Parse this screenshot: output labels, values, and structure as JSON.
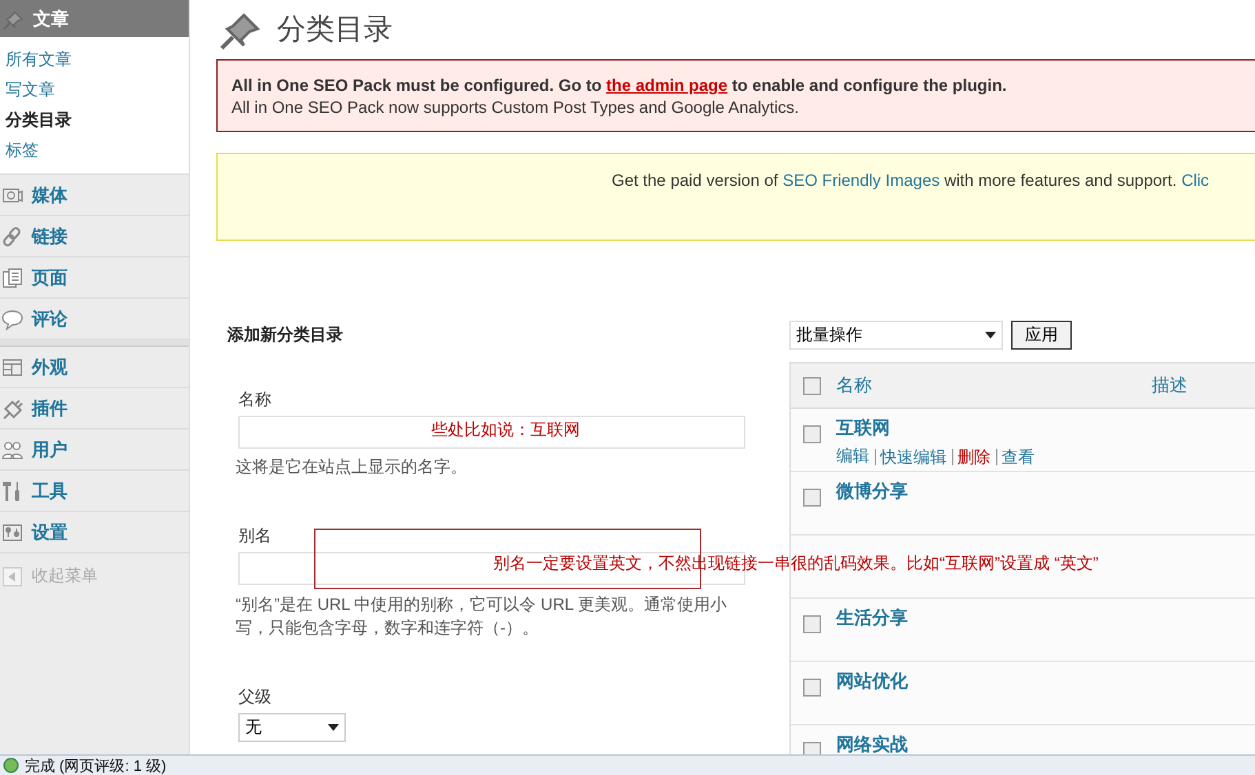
{
  "sidebar": {
    "header": {
      "label": "文章"
    },
    "submenu": [
      {
        "label": "所有文章",
        "selected": false
      },
      {
        "label": "写文章",
        "selected": false
      },
      {
        "label": "分类目录",
        "selected": true
      },
      {
        "label": "标签",
        "selected": false
      }
    ],
    "menu_groups": [
      [
        {
          "label": "媒体"
        },
        {
          "label": "链接"
        },
        {
          "label": "页面"
        },
        {
          "label": "评论"
        }
      ],
      [
        {
          "label": "外观"
        },
        {
          "label": "插件"
        },
        {
          "label": "用户"
        },
        {
          "label": "工具"
        },
        {
          "label": "设置"
        }
      ]
    ],
    "collapse": {
      "label": "收起菜单"
    }
  },
  "page": {
    "title": "分类目录"
  },
  "notices": [
    {
      "kind": "error",
      "lead": "All in One SEO Pack must be configured. Go to",
      "link": "the admin page",
      "tail": "to enable and configure the plugin.",
      "line2": "All in One SEO Pack now supports Custom Post Types and Google Analytics."
    },
    {
      "kind": "info",
      "lead": "Get the paid version of",
      "link": "SEO Friendly Images",
      "tail": "with more features and support.",
      "link2": "Clic"
    }
  ],
  "form": {
    "heading": "添加新分类目录",
    "fields": [
      {
        "kind": "text",
        "label": "名称",
        "help": "这将是它在站点上显示的名字。"
      },
      {
        "kind": "text",
        "label": "别名",
        "help": "“别名”是在 URL 中使用的别称，它可以令 URL 更美观。通常使用小写，只能包含字母，数字和连字符（-）。"
      },
      {
        "kind": "select",
        "label": "父级",
        "value": "无"
      }
    ]
  },
  "table": {
    "bulk_action": "批量操作",
    "apply": "应用",
    "columns": [
      "名称",
      "描述"
    ],
    "select_all_checked": false,
    "rows": [
      {
        "kind": "item",
        "name": "互联网",
        "checked": false,
        "actions": [
          {
            "label": "编辑",
            "kind": "normal"
          },
          {
            "label": "快速编辑",
            "kind": "normal"
          },
          {
            "label": "删除",
            "kind": "delete"
          },
          {
            "label": "查看",
            "kind": "normal"
          }
        ]
      },
      {
        "kind": "item",
        "name": "微博分享",
        "checked": false
      },
      {
        "kind": "covered"
      },
      {
        "kind": "item",
        "name": "生活分享",
        "checked": false
      },
      {
        "kind": "item",
        "name": "网站优化",
        "checked": false
      },
      {
        "kind": "item",
        "name": "网络实战",
        "checked": false
      }
    ]
  },
  "annotations": [
    {
      "kind": "text",
      "text": "些处比如说：互联网"
    },
    {
      "kind": "box"
    },
    {
      "kind": "text",
      "text": "别名一定要设置英文，不然出现链接一串很的乱码效果。比如“互联网”设置成 “英文”"
    }
  ],
  "status_bar": {
    "text": "完成 (网页评级: 1 级)"
  }
}
